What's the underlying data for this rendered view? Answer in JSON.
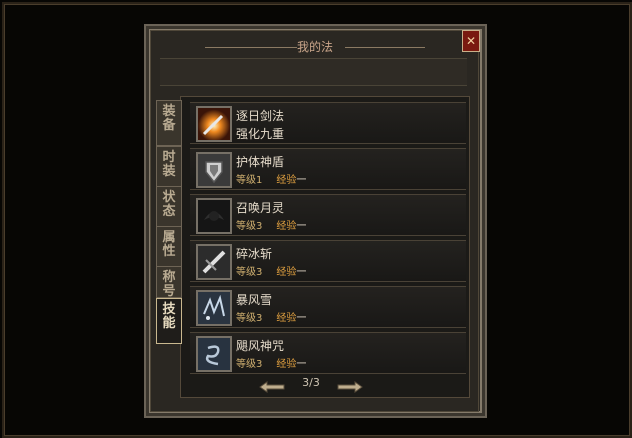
{
  "window": {
    "title": "我的法"
  },
  "tabs": [
    {
      "label": "装备",
      "active": false
    },
    {
      "label": "时装",
      "active": false
    },
    {
      "label": "状态",
      "active": false
    },
    {
      "label": "属性",
      "active": false
    },
    {
      "label": "称号",
      "active": false
    },
    {
      "label": "技能",
      "active": true
    }
  ],
  "skills": [
    {
      "name": "逐日剑法",
      "line2": "强化九重",
      "icon": "flame-sword-icon"
    },
    {
      "name": "护体神盾",
      "level_label": "等级",
      "level": "1",
      "exp_label": "经验",
      "exp": "一",
      "icon": "shield-icon"
    },
    {
      "name": "召唤月灵",
      "level_label": "等级",
      "level": "3",
      "exp_label": "经验",
      "exp": "一",
      "icon": "moon-spirit-icon"
    },
    {
      "name": "碎冰斩",
      "level_label": "等级",
      "level": "3",
      "exp_label": "经验",
      "exp": "一",
      "icon": "ice-slash-icon"
    },
    {
      "name": "暴风雪",
      "level_label": "等级",
      "level": "3",
      "exp_label": "经验",
      "exp": "一",
      "icon": "blizzard-icon"
    },
    {
      "name": "飓风神咒",
      "level_label": "等级",
      "level": "3",
      "exp_label": "经验",
      "exp": "一",
      "icon": "hurricane-icon"
    }
  ],
  "pager": {
    "text": "3/3"
  }
}
